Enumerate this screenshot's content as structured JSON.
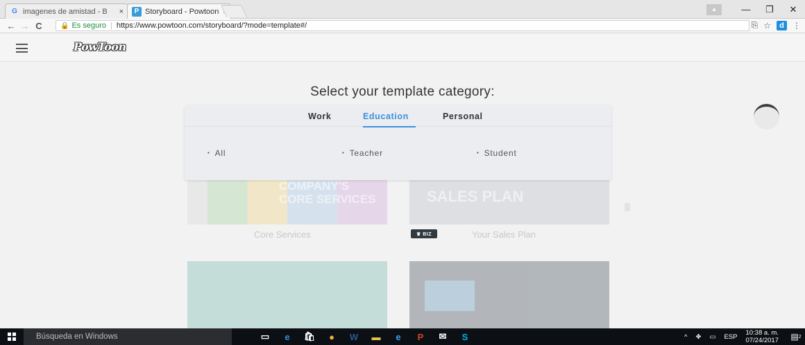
{
  "browser": {
    "tabs": [
      {
        "title": "imagenes de amistad - B",
        "favicon": "G",
        "favicon_color": "#4285f4"
      },
      {
        "title": "Storyboard - Powtoon",
        "favicon": "P",
        "favicon_color": "#3a9bd9"
      }
    ],
    "tab_close": "×",
    "window_controls": {
      "minimize": "—",
      "maximize": "❐",
      "close": "✕"
    },
    "nav": {
      "back": "←",
      "forward": "→",
      "reload": "C"
    },
    "address": {
      "secure_label": "Es seguro",
      "separator": "|",
      "url": "https://www.powtoon.com/storyboard/?mode=template#/"
    },
    "toolbar_icons": {
      "translate": "⎘",
      "star": "☆",
      "extension": "d",
      "menu": "⋮"
    }
  },
  "app": {
    "logo_text": "PowToon",
    "heading": "Select your template category:",
    "category_tabs": [
      {
        "label": "Work",
        "active": false
      },
      {
        "label": "Education",
        "active": true
      },
      {
        "label": "Personal",
        "active": false
      }
    ],
    "subcategories": [
      "All",
      "Teacher",
      "Student"
    ],
    "bullet": "•",
    "background_cards": [
      {
        "title": "Core Services",
        "art_text": "COMPANY'S CORE SERVICES"
      },
      {
        "title": "Your Sales Plan",
        "art_text": "SALES PLAN",
        "badge": "♛ BIZ"
      }
    ],
    "accent_color": "#3f8fe0"
  },
  "taskbar": {
    "search_placeholder": "Búsqueda en Windows",
    "apps": [
      {
        "name": "task-view-icon",
        "glyph": "▭",
        "color": "#ffffff"
      },
      {
        "name": "edge-icon",
        "glyph": "e",
        "color": "#2f8fe0"
      },
      {
        "name": "store-icon",
        "glyph": "🛍",
        "color": "#ffffff"
      },
      {
        "name": "chrome-icon",
        "glyph": "●",
        "color": "#e8b33a"
      },
      {
        "name": "word-icon",
        "glyph": "W",
        "color": "#2b5797"
      },
      {
        "name": "explorer-icon",
        "glyph": "▬",
        "color": "#e8c048"
      },
      {
        "name": "ie-icon",
        "glyph": "e",
        "color": "#3aa0e8"
      },
      {
        "name": "powerpoint-icon",
        "glyph": "P",
        "color": "#d24726"
      },
      {
        "name": "mail-icon",
        "glyph": "✉",
        "color": "#ffffff"
      },
      {
        "name": "skype-icon",
        "glyph": "S",
        "color": "#00aff0"
      }
    ],
    "tray": {
      "chevron": "^",
      "lang": "ESP",
      "time": "10:38 a. m.",
      "date": "07/24/2017",
      "notifications": "2"
    }
  }
}
